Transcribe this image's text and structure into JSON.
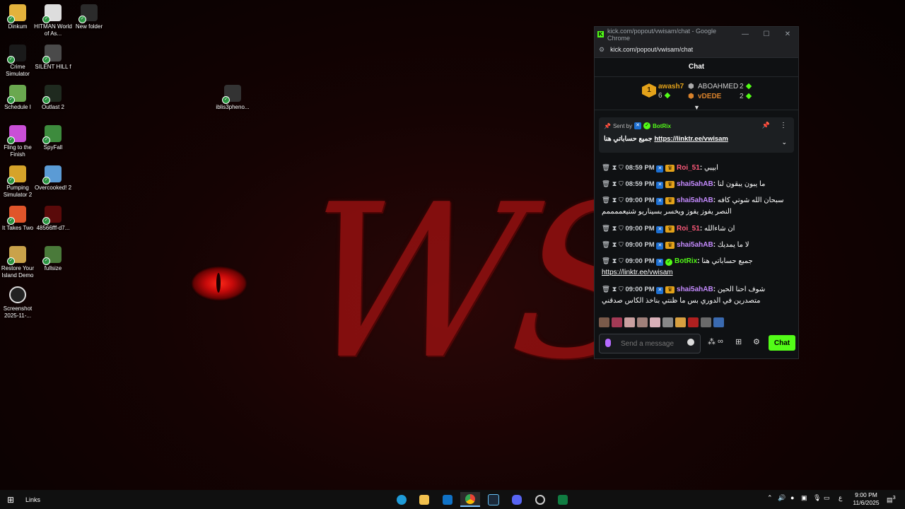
{
  "desktop": {
    "icons": [
      {
        "label": "Dinkum"
      },
      {
        "label": "HITMAN World of As..."
      },
      {
        "label": "New folder"
      },
      {
        "label": "Crime Simulator"
      },
      {
        "label": "SILENT HILL f"
      },
      {
        "label": "Schedule I"
      },
      {
        "label": "Outlast 2"
      },
      {
        "label": "iblis3pheno..."
      },
      {
        "label": "Fling to the Finish"
      },
      {
        "label": "SpyFall"
      },
      {
        "label": "Pumping Simulator 2"
      },
      {
        "label": "Overcooked! 2"
      },
      {
        "label": "It Takes Two"
      },
      {
        "label": "48566fff-d7..."
      },
      {
        "label": "Restore Your Island Demo"
      },
      {
        "label": "fullsize"
      },
      {
        "label": "Screenshot 2025-11-..."
      }
    ],
    "wallpaper_text": "WS"
  },
  "browser": {
    "title": "kick.com/popout/vwisam/chat - Google Chrome",
    "url": "kick.com/popout/vwisam/chat"
  },
  "chat": {
    "header": "Chat",
    "leaderboard": {
      "first": {
        "rank": "1",
        "name": "awash7",
        "count": "6"
      },
      "second": {
        "name": "ABOAHMED",
        "count": "2"
      },
      "third": {
        "name": "vDEDE",
        "count": "2"
      }
    },
    "pinned": {
      "sent_by_label": "Sent by",
      "sender": "BotRix",
      "text": "جميع حساباتي هنا",
      "link": "https://linktr.ee/vwisam"
    },
    "messages": [
      {
        "time": "08:59 PM",
        "user": "Roi_51",
        "text": "ابيبي",
        "color": "#ff5a7a"
      },
      {
        "time": "08:59 PM",
        "user": "shai5ahAB",
        "text": "ما يبون يبقون لنا",
        "color": "#c58bff"
      },
      {
        "time": "09:00 PM",
        "user": "shai5ahAB",
        "text": "سبحان الله شوتي كافه النصر يفوز يفوز ويخسر بسيناريو شنيعممممم",
        "color": "#c58bff"
      },
      {
        "time": "09:00 PM",
        "user": "Roi_51",
        "text": "ان شاءالله",
        "color": "#ff5a7a"
      },
      {
        "time": "09:00 PM",
        "user": "shai5ahAB",
        "text": "لا ما يمديك",
        "color": "#c58bff"
      },
      {
        "time": "09:00 PM",
        "user": "BotRix",
        "text": "جميع حساباتي هنا",
        "link": "https://linktr.ee/vwisam",
        "color": "#53fc18"
      },
      {
        "time": "09:00 PM",
        "user": "shai5ahAB",
        "text": "شوف احنا الحين متصدرين في الدوري بس ما ظنتي بناخذ الكاس صدقني",
        "color": "#c58bff"
      }
    ],
    "input_placeholder": "Send a message",
    "send_label": "Chat"
  },
  "taskbar": {
    "links_label": "Links",
    "time": "9:00 PM",
    "date": "11/6/2025",
    "notification_count": "3",
    "lang": "ع"
  },
  "colors": {
    "kick_green": "#53fc18",
    "gold": "#e3a21a"
  }
}
